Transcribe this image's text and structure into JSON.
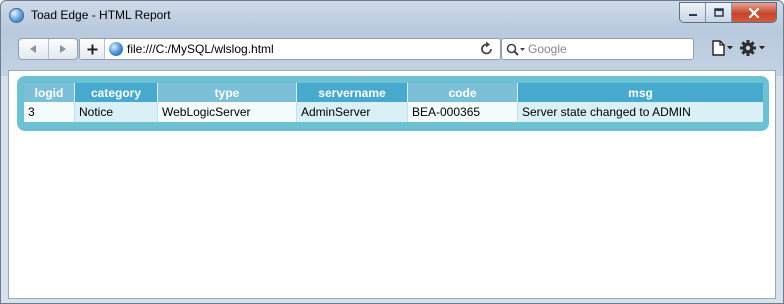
{
  "window": {
    "title": "Toad Edge - HTML Report",
    "close_color": "#c7452c"
  },
  "toolbar": {
    "url": "file:///C:/MySQL/wlslog.html",
    "search_placeholder": "Google",
    "back_icon": "back-arrow-icon",
    "forward_icon": "forward-arrow-icon",
    "reload_icon": "reload-icon",
    "page_icon": "page-menu-icon",
    "tools_icon": "gear-icon"
  },
  "report": {
    "header_colors": [
      "#7bbfd9",
      "#46a9cd"
    ],
    "frame_color": "#6cc1d3",
    "columns": [
      "logid",
      "category",
      "type",
      "servername",
      "code",
      "msg"
    ],
    "rows": [
      [
        "3",
        "Notice",
        "WebLogicServer",
        "AdminServer",
        "BEA-000365",
        "Server state changed to ADMIN"
      ]
    ]
  }
}
